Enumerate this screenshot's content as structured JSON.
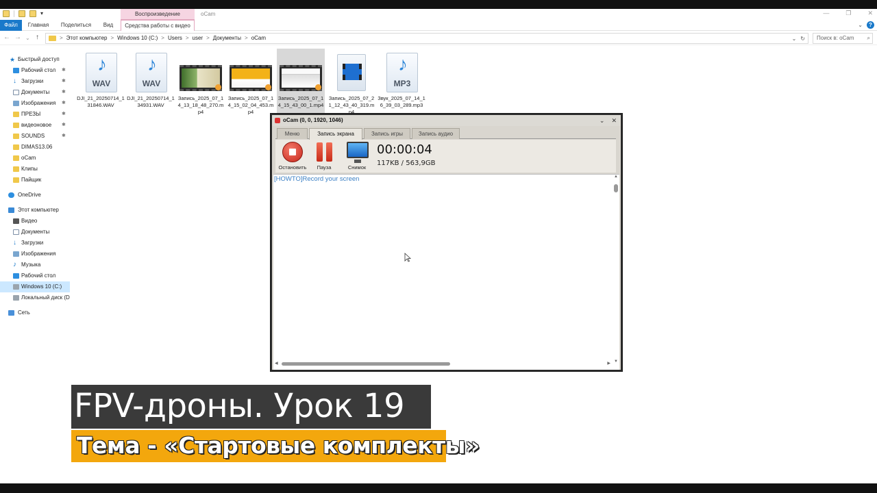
{
  "explorer": {
    "context_tab_header": "Воспроизведение",
    "window_title": "oCam",
    "window_controls": [
      "—",
      "❐",
      "✕"
    ],
    "ribbon_tabs": [
      {
        "label": "Файл"
      },
      {
        "label": "Главная"
      },
      {
        "label": "Поделиться"
      },
      {
        "label": "Вид"
      },
      {
        "label": "Средства работы с видео"
      }
    ],
    "nav_buttons": [
      "←",
      "→",
      "⌄",
      "↑"
    ],
    "address": {
      "segments": [
        "Этот компьютер",
        "Windows 10 (C:)",
        "Users",
        "user",
        "Документы",
        "oCam"
      ],
      "separator": ">",
      "dropdown": "⌄",
      "refresh": "↻"
    },
    "search_placeholder": "Поиск в: oCam",
    "sidebar": [
      {
        "label": "Быстрый доступ",
        "icon": "star-icon",
        "pinned": false
      },
      {
        "label": "Рабочий стол",
        "icon": "desktop-icon",
        "pinned": true
      },
      {
        "label": "Загрузки",
        "icon": "download-icon",
        "pinned": true
      },
      {
        "label": "Документы",
        "icon": "documents-icon",
        "pinned": true
      },
      {
        "label": "Изображения",
        "icon": "pictures-icon",
        "pinned": true
      },
      {
        "label": "ПРЕЗЫ",
        "icon": "folder-icon",
        "pinned": true
      },
      {
        "label": "видеоновое",
        "icon": "folder-icon",
        "pinned": true
      },
      {
        "label": "SOUNDS",
        "icon": "folder-icon",
        "pinned": true
      },
      {
        "label": "DIMAS13.06",
        "icon": "folder-icon",
        "pinned": false
      },
      {
        "label": "oCam",
        "icon": "folder-icon",
        "pinned": false
      },
      {
        "label": "Клипы",
        "icon": "folder-icon",
        "pinned": false
      },
      {
        "label": "Пайщик",
        "icon": "folder-icon",
        "pinned": false
      },
      {
        "label": "OneDrive",
        "icon": "onedrive-icon",
        "pinned": false
      },
      {
        "label": "Этот компьютер",
        "icon": "computer-icon",
        "pinned": false
      },
      {
        "label": "Видео",
        "icon": "video-icon",
        "pinned": false
      },
      {
        "label": "Документы",
        "icon": "documents-icon",
        "pinned": false
      },
      {
        "label": "Загрузки",
        "icon": "download-icon",
        "pinned": false
      },
      {
        "label": "Изображения",
        "icon": "pictures-icon",
        "pinned": false
      },
      {
        "label": "Музыка",
        "icon": "music-icon",
        "pinned": false
      },
      {
        "label": "Рабочий стол",
        "icon": "desktop-icon",
        "pinned": false
      },
      {
        "label": "Windows 10 (C:)",
        "icon": "drive-icon",
        "pinned": false,
        "selected": true
      },
      {
        "label": "Локальный диск (D",
        "icon": "drive-icon",
        "pinned": false
      },
      {
        "label": "Сеть",
        "icon": "network-icon",
        "pinned": false
      }
    ],
    "pin_glyph": "✱",
    "files": [
      {
        "name": "DJI_21_20250714_131846.WAV",
        "kind": "audio",
        "ext": "WAV"
      },
      {
        "name": "DJI_21_20250714_134931.WAV",
        "kind": "audio",
        "ext": "WAV"
      },
      {
        "name": "Запись_2025_07_14_13_18_48_270.mp4",
        "kind": "video"
      },
      {
        "name": "Запись_2025_07_14_15_02_04_453.mp4",
        "kind": "video"
      },
      {
        "name": "Запись_2025_07_14_15_43_00_1.mp4",
        "kind": "video",
        "hovered": true
      },
      {
        "name": "Запись_2025_07_21_12_43_40_319.mp4",
        "kind": "video-icon"
      },
      {
        "name": "Звук_2025_07_14_16_39_03_289.mp3",
        "kind": "audio",
        "ext": "MP3"
      }
    ]
  },
  "ocam": {
    "title": "oCam (0, 0, 1920, 1046)",
    "controls": [
      "⌄",
      "✕"
    ],
    "tabs": [
      {
        "label": "Меню"
      },
      {
        "label": "Запись экрана",
        "active": true
      },
      {
        "label": "Запись игры"
      },
      {
        "label": "Запись аудио"
      }
    ],
    "buttons": {
      "stop": "Остановить",
      "pause": "Пауза",
      "snapshot": "Снимок"
    },
    "timer": "00:00:04",
    "size": "117KB / 563,9GB",
    "log_link": "[HOWTO]Record your screen"
  },
  "captions": {
    "title": "FPV-дроны. Урок 19",
    "subtitle": "Тема - «Стартовые комплекты»"
  }
}
